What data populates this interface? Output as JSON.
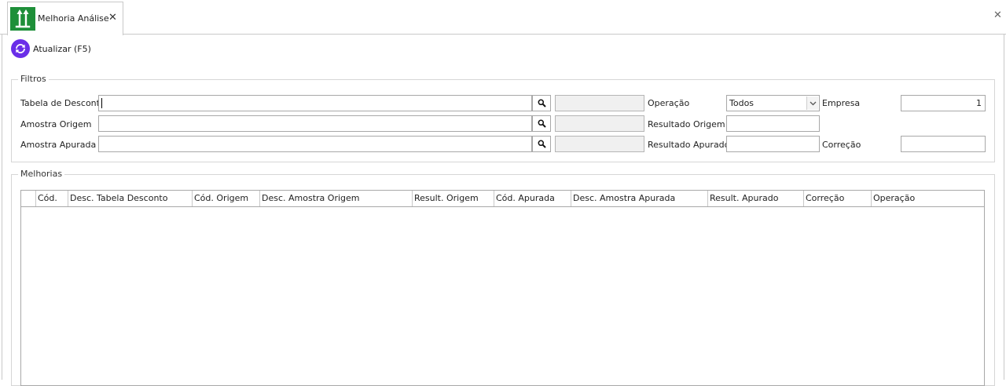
{
  "tab": {
    "title": "Melhoria Análise",
    "icon": "sort-up-arrows-icon",
    "close_symbol": "✕"
  },
  "window": {
    "close_symbol": "✕"
  },
  "toolbar": {
    "refresh_label": "Atualizar (F5)",
    "refresh_icon": "refresh-icon",
    "refresh_color": "#6a2ee8"
  },
  "filters": {
    "legend": "Filtros",
    "tabela_desconto": {
      "label": "Tabela de Desconto",
      "value": "",
      "description": ""
    },
    "amostra_origem": {
      "label": "Amostra Origem",
      "value": "",
      "description": ""
    },
    "amostra_apurada": {
      "label": "Amostra Apurada",
      "value": "",
      "description": ""
    },
    "operacao": {
      "label": "Operação",
      "selected": "Todos"
    },
    "resultado_origem": {
      "label": "Resultado Origem",
      "value": ""
    },
    "resultado_apurado": {
      "label": "Resultado Apurado",
      "value": ""
    },
    "empresa": {
      "label": "Empresa",
      "value": "1"
    },
    "correcao": {
      "label": "Correção",
      "value": ""
    }
  },
  "melhorias": {
    "legend": "Melhorias",
    "columns": [
      "",
      "Cód.",
      "Desc. Tabela Desconto",
      "Cód. Origem",
      "Desc. Amostra Origem",
      "Result. Origem",
      "Cód. Apurada",
      "Desc. Amostra Apurada",
      "Result. Apurado",
      "Correção",
      "Operação"
    ],
    "rows": []
  },
  "colors": {
    "tab_icon_bg": "#1e8f39",
    "accent": "#6a2ee8"
  }
}
